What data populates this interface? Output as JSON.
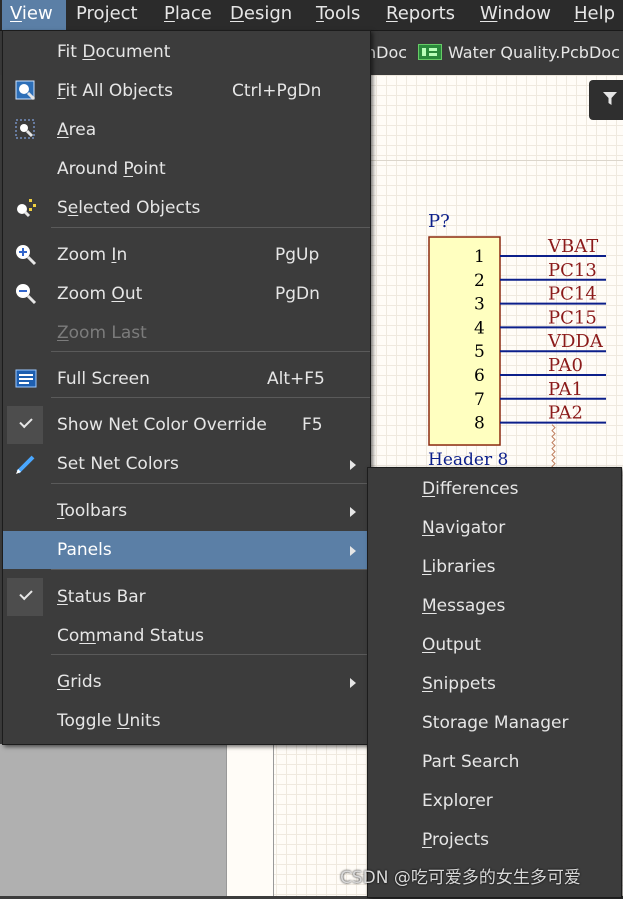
{
  "menubar": {
    "items": [
      {
        "label": "View",
        "accel": "V"
      },
      {
        "label": "Project",
        "accel": "j"
      },
      {
        "label": "Place",
        "accel": "P"
      },
      {
        "label": "Design",
        "accel": "D"
      },
      {
        "label": "Tools",
        "accel": "T"
      },
      {
        "label": "Reports",
        "accel": "R"
      },
      {
        "label": "Window",
        "accel": "W"
      },
      {
        "label": "Help",
        "accel": "H"
      }
    ]
  },
  "tabs": {
    "partial_tab": "hDoc",
    "active_tab": "Water Quality.PcbDoc"
  },
  "view_menu": {
    "items": [
      {
        "pre": "Fit ",
        "u": "D",
        "post": "ocument",
        "shortcut": "",
        "icon": "",
        "submenu": false
      },
      {
        "pre": "",
        "u": "F",
        "post": "it All Objects",
        "shortcut": "Ctrl+PgDn",
        "icon": "fit-all-objects-icon",
        "submenu": false
      },
      {
        "pre": "",
        "u": "A",
        "post": "rea",
        "shortcut": "",
        "icon": "area-zoom-icon",
        "submenu": false
      },
      {
        "pre": "Around ",
        "u": "P",
        "post": "oint",
        "shortcut": "",
        "icon": "",
        "submenu": false
      },
      {
        "pre": "S",
        "u": "e",
        "post": "lected Objects",
        "shortcut": "",
        "icon": "selected-objects-icon",
        "submenu": false
      },
      {
        "pre": "Zoom ",
        "u": "I",
        "post": "n",
        "shortcut": "PgUp",
        "icon": "zoom-in-icon",
        "submenu": false
      },
      {
        "pre": "Zoom ",
        "u": "O",
        "post": "ut",
        "shortcut": "PgDn",
        "icon": "zoom-out-icon",
        "submenu": false
      },
      {
        "pre": "",
        "u": "Z",
        "post": "oom Last",
        "shortcut": "",
        "icon": "",
        "submenu": false,
        "disabled": true
      },
      {
        "pre": "Full Screen",
        "u": "",
        "post": "",
        "shortcut": "Alt+F5",
        "icon": "full-screen-icon",
        "submenu": false
      },
      {
        "pre": "Show Net Color Override",
        "u": "",
        "post": "",
        "shortcut": "F5",
        "icon": "checkmark-icon",
        "submenu": false,
        "checked": true
      },
      {
        "pre": "Set Net Colors",
        "u": "",
        "post": "",
        "shortcut": "",
        "icon": "pen-icon",
        "submenu": true
      },
      {
        "pre": "",
        "u": "T",
        "post": "oolbars",
        "shortcut": "",
        "icon": "",
        "submenu": true
      },
      {
        "pre": "Panels",
        "u": "",
        "post": "",
        "shortcut": "",
        "icon": "",
        "submenu": true,
        "highlight": true
      },
      {
        "pre": "",
        "u": "S",
        "post": "tatus Bar",
        "shortcut": "",
        "icon": "checkmark-icon",
        "submenu": false,
        "checked": true
      },
      {
        "pre": "Co",
        "u": "m",
        "post": "mand Status",
        "shortcut": "",
        "icon": "",
        "submenu": false
      },
      {
        "pre": "",
        "u": "G",
        "post": "rids",
        "shortcut": "",
        "icon": "",
        "submenu": true
      },
      {
        "pre": "Toggle ",
        "u": "U",
        "post": "nits",
        "shortcut": "",
        "icon": "",
        "submenu": false
      }
    ]
  },
  "panels_menu": {
    "items": [
      {
        "pre": "",
        "u": "D",
        "post": "ifferences"
      },
      {
        "pre": "",
        "u": "N",
        "post": "avigator"
      },
      {
        "pre": "",
        "u": "L",
        "post": "ibraries"
      },
      {
        "pre": "",
        "u": "M",
        "post": "essages"
      },
      {
        "pre": "",
        "u": "O",
        "post": "utput"
      },
      {
        "pre": "",
        "u": "S",
        "post": "nippets"
      },
      {
        "pre": "Storage Manager",
        "u": "",
        "post": ""
      },
      {
        "pre": "Part Search",
        "u": "",
        "post": ""
      },
      {
        "pre": "Explo",
        "u": "r",
        "post": "er"
      },
      {
        "pre": "",
        "u": "P",
        "post": "rojects"
      },
      {
        "pre": "",
        "u": "",
        "post": ""
      }
    ]
  },
  "schematic": {
    "designator": "P?",
    "comment": "Header 8",
    "pins": [
      "1",
      "2",
      "3",
      "4",
      "5",
      "6",
      "7",
      "8"
    ],
    "nets": [
      "VBAT",
      "PC13",
      "PC14",
      "PC15",
      "VDDA",
      "PA0",
      "PA1",
      "PA2"
    ]
  },
  "watermark": "CSDN @吃可爱多的女生多可爱",
  "colors": {
    "menu_bg": "#3c3c3c",
    "highlight": "#5b7fa6",
    "menubar_bg": "#2b2b2b",
    "component_fill": "#ffffc0",
    "component_border": "#8b2a10",
    "wire": "#0c1f8a",
    "net_label": "#8b1a1a"
  }
}
